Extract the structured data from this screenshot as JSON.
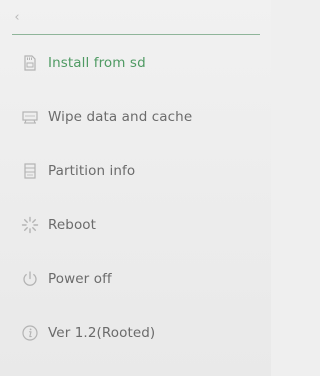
{
  "header": {
    "back_icon": "chevron-left-icon",
    "back_glyph": "‹"
  },
  "colors": {
    "accent": "#4f9a63",
    "text": "#6b6b6b",
    "divider": "#8fb59a",
    "icon": "#b3b3b3"
  },
  "menu": {
    "items": [
      {
        "label": "Install from sd",
        "icon": "sd-card-icon",
        "active": true
      },
      {
        "label": "Wipe data and cache",
        "icon": "wipe-drive-icon",
        "active": false
      },
      {
        "label": "Partition info",
        "icon": "partition-icon",
        "active": false
      },
      {
        "label": "Reboot",
        "icon": "reboot-spinner-icon",
        "active": false
      },
      {
        "label": "Power off",
        "icon": "power-icon",
        "active": false
      },
      {
        "label": "Ver 1.2(Rooted)",
        "icon": "info-icon",
        "active": false
      }
    ]
  }
}
